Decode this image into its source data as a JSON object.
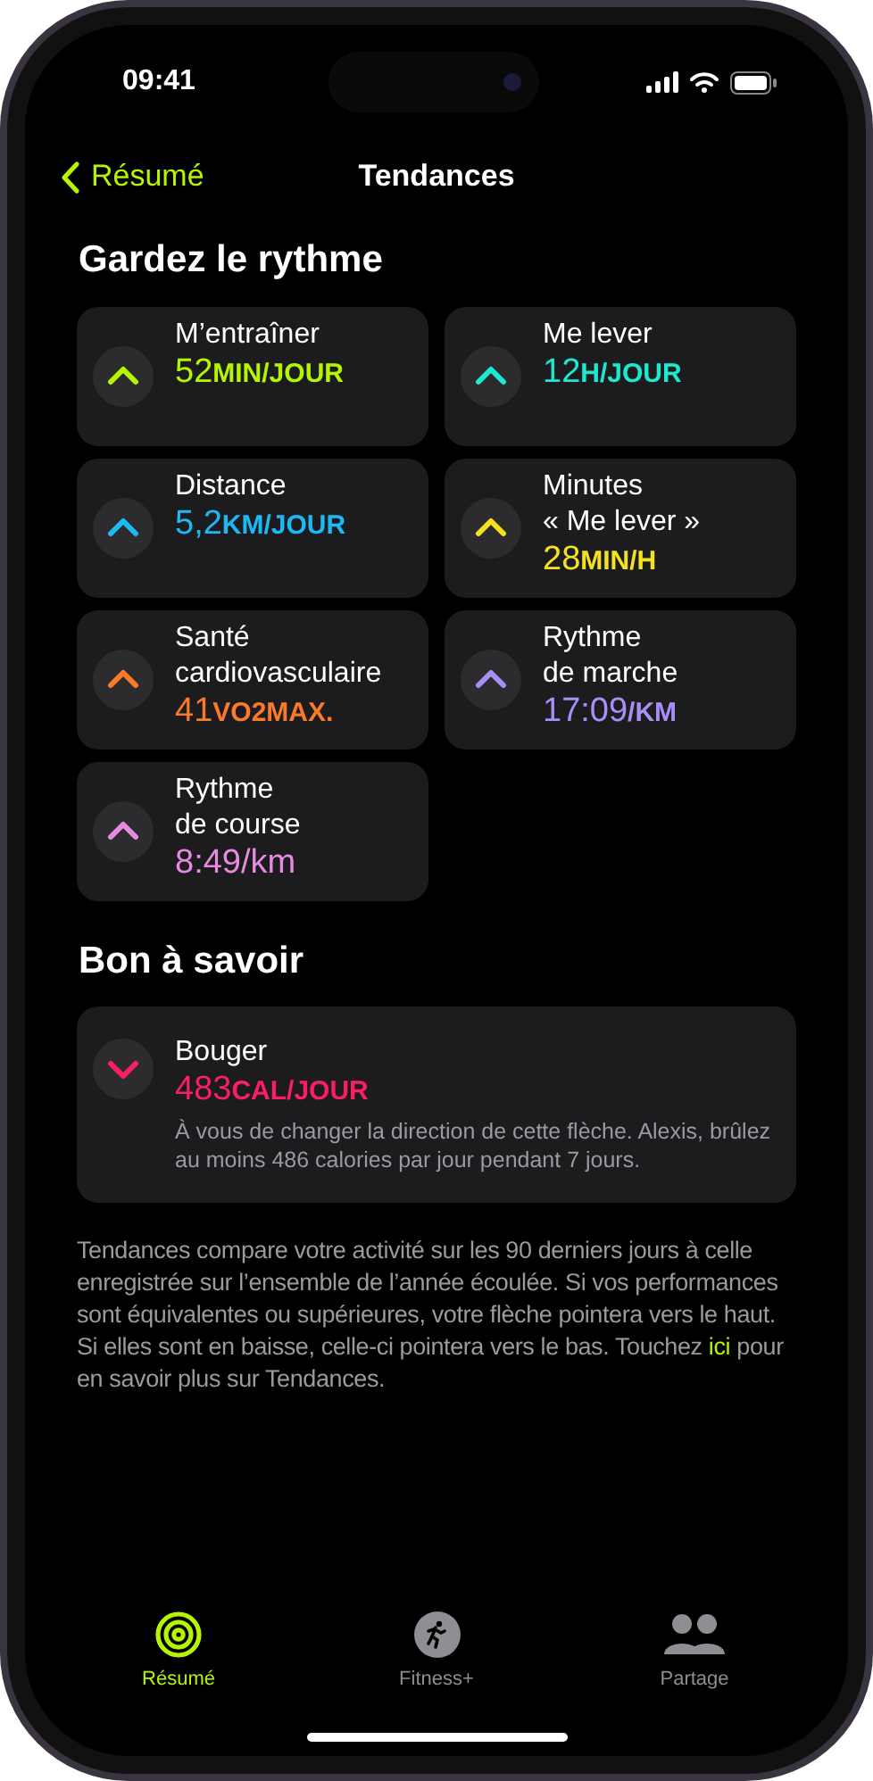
{
  "status_bar": {
    "time": "09:41"
  },
  "nav": {
    "back": "Résumé",
    "title": "Tendances"
  },
  "sections": [
    {
      "title": "Gardez le rythme",
      "metrics": [
        {
          "name": [
            "M’entraîner"
          ],
          "value": "52",
          "unit": "MIN/JOUR",
          "rising": true,
          "color": "#b6f500"
        },
        {
          "name": [
            "Me lever"
          ],
          "value": "12",
          "unit": "H/JOUR",
          "rising": true,
          "color": "#1ee8d0"
        },
        {
          "name": [
            "Distance"
          ],
          "value": "5,2",
          "unit": "KM/JOUR",
          "rising": true,
          "color": "#1eb8f5"
        },
        {
          "name": [
            "Minutes",
            "« Me lever »"
          ],
          "value": "28",
          "unit": "MIN/H",
          "rising": true,
          "color": "#f5e21e"
        },
        {
          "name": [
            "Santé",
            "cardiovasculaire"
          ],
          "value": "41",
          "unit": "VO2MAX.",
          "rising": true,
          "color": "#fa7a2a"
        },
        {
          "name": [
            "Rythme",
            "de marche"
          ],
          "value": "17:09",
          "unit": "/KM",
          "rising": true,
          "color": "#a98ef5"
        },
        {
          "name": [
            "Rythme",
            "de course"
          ],
          "value": "8:49/km",
          "rising": true,
          "color": "#e88ae0"
        }
      ]
    },
    {
      "title": "Bon à savoir",
      "metrics": [
        {
          "name": [
            "Bouger"
          ],
          "value": "483",
          "unit": "CAL/JOUR",
          "rising": false,
          "color": "#fa1e62",
          "note": "À vous de changer la direction de cette flèche. Alexis, brûlez au moins 486 calories par jour pendant 7 jours."
        }
      ]
    }
  ],
  "footnote": {
    "before": "Tendances compare votre activité sur les 90 derniers jours à celle enregistrée sur l’ensemble de l’année écoulée. Si vos performances sont équivalentes ou supérieures, votre flèche pointera vers le haut. Si elles sont en baisse, celle-ci pointera vers le bas. Touchez",
    "link": "ici",
    "after": "pour en savoir plus sur Tendances."
  },
  "tab_bar": [
    {
      "kind": "rings",
      "label": "Résumé",
      "selected": true
    },
    {
      "kind": "fitness",
      "label": "Fitness+",
      "selected": false
    },
    {
      "kind": "people",
      "label": "Partage",
      "selected": false
    }
  ]
}
